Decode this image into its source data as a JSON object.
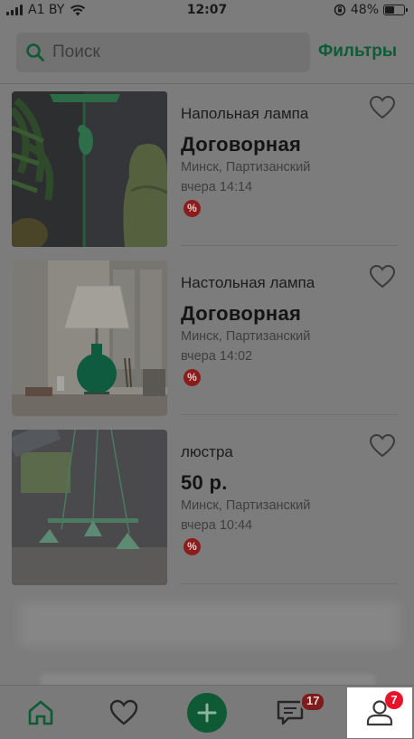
{
  "status_bar": {
    "carrier": "A1 BY",
    "time": "12:07",
    "battery": "48%",
    "battery_level": 0.48
  },
  "search": {
    "placeholder": "Поиск",
    "filters_label": "Фильтры"
  },
  "listings": [
    {
      "title": "Напольная лампа",
      "price": "Договорная",
      "location": "Минск, Партизанский",
      "time": "вчера 14:14",
      "discount_badge": "%",
      "favorite_icon": "heart-outline-icon"
    },
    {
      "title": "Настольная лампа",
      "price": "Договорная",
      "location": "Минск, Партизанский",
      "time": "вчера 14:02",
      "discount_badge": "%",
      "favorite_icon": "heart-outline-icon"
    },
    {
      "title": "люстра",
      "price": "50 р.",
      "location": "Минск, Партизанский",
      "time": "вчера 10:44",
      "discount_badge": "%",
      "favorite_icon": "heart-outline-icon"
    }
  ],
  "tab_bar": {
    "items": [
      {
        "name": "home",
        "icon": "home-icon"
      },
      {
        "name": "favorites",
        "icon": "heart-icon"
      },
      {
        "name": "add",
        "icon": "plus-icon"
      },
      {
        "name": "messages",
        "icon": "chat-icon",
        "badge": "17"
      },
      {
        "name": "profile",
        "icon": "user-icon",
        "badge": "7"
      }
    ]
  },
  "colors": {
    "accent": "#0e5a35",
    "badge": "#e8132b",
    "overlay_background": "#7c7c7c"
  }
}
